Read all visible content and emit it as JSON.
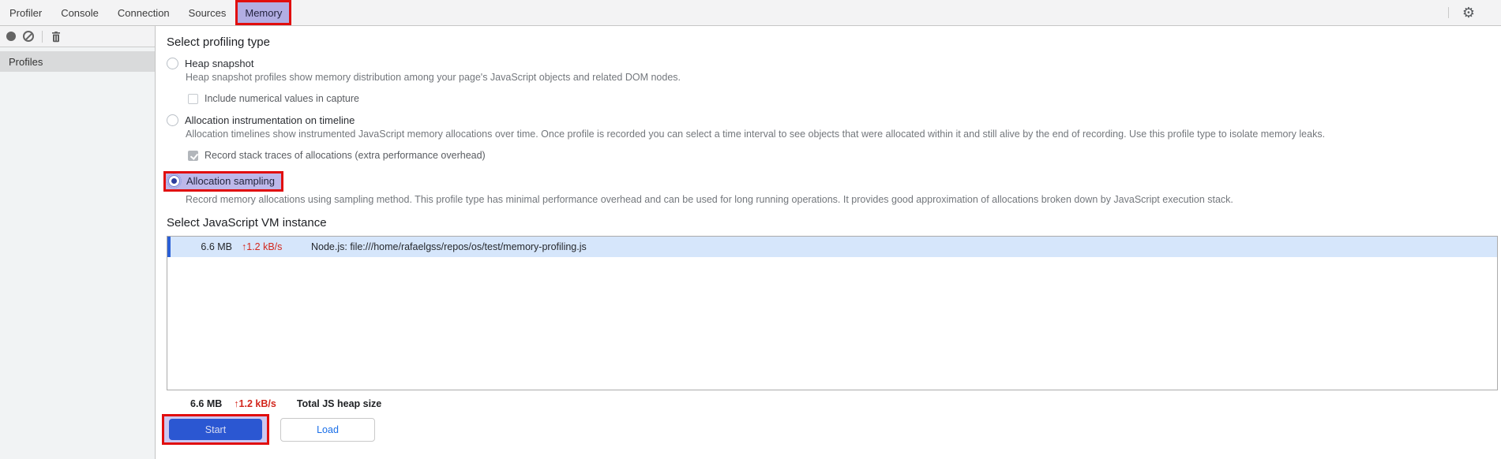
{
  "tabs": {
    "items": [
      {
        "label": "Profiler",
        "selected": false
      },
      {
        "label": "Console",
        "selected": false
      },
      {
        "label": "Connection",
        "selected": false
      },
      {
        "label": "Sources",
        "selected": false
      },
      {
        "label": "Memory",
        "selected": true,
        "annotated": true
      }
    ],
    "icons": [
      "gear-icon"
    ]
  },
  "toolbar": {
    "icons": [
      "record-icon",
      "clear-icon",
      "trash-icon"
    ]
  },
  "sidebar": {
    "header": "Profiles"
  },
  "profiling": {
    "title": "Select profiling type",
    "options": [
      {
        "label": "Heap snapshot",
        "selected": false,
        "description": "Heap snapshot profiles show memory distribution among your page's JavaScript objects and related DOM nodes.",
        "suboption": {
          "label": "Include numerical values in capture",
          "checked": false
        }
      },
      {
        "label": "Allocation instrumentation on timeline",
        "selected": false,
        "description": "Allocation timelines show instrumented JavaScript memory allocations over time. Once profile is recorded you can select a time interval to see objects that were allocated within it and still alive by the end of recording. Use this profile type to isolate memory leaks.",
        "suboption": {
          "label": "Record stack traces of allocations (extra performance overhead)",
          "checked": true
        }
      },
      {
        "label": "Allocation sampling",
        "selected": true,
        "annotated": true,
        "description": "Record memory allocations using sampling method. This profile type has minimal performance overhead and can be used for long running operations. It provides good approximation of allocations broken down by JavaScript execution stack."
      }
    ]
  },
  "vm": {
    "title": "Select JavaScript VM instance",
    "instances": [
      {
        "size": "6.6 MB",
        "arrow": "↑",
        "rate": "1.2 kB/s",
        "name": "Node.js: file:///home/rafaelgss/repos/os/test/memory-profiling.js",
        "selected": true
      }
    ],
    "total": {
      "size": "6.6 MB",
      "arrow": "↑",
      "rate": "1.2 kB/s",
      "label": "Total JS heap size"
    }
  },
  "actions": {
    "start_label": "Start",
    "load_label": "Load"
  },
  "colors": {
    "accent_blue": "#2b57d2",
    "selection_row_blue": "#d6e6fb",
    "row_bar_blue": "#2a5fd7",
    "link_blue": "#1a6fe8",
    "rate_red": "#d3271d",
    "annotation_red": "#e10e0e",
    "annotation_purple": "#b2aee3",
    "tab_bg": "#f3f3f4",
    "profiles_header_bg": "#d9dadb"
  }
}
